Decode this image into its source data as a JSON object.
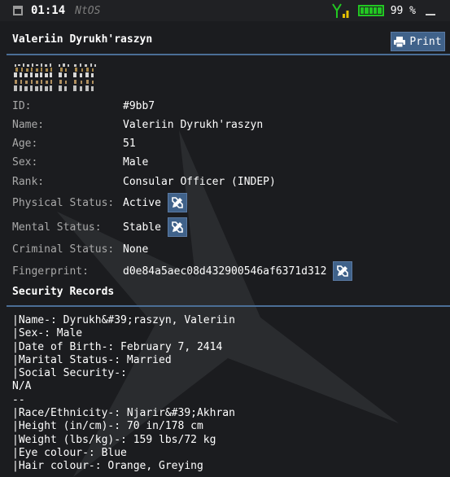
{
  "statusbar": {
    "time": "01:14",
    "os_name": "NtOS",
    "battery_percent": "99 %",
    "icons": [
      "calendar-icon",
      "signal-icon",
      "battery-icon",
      "minimize-icon"
    ],
    "colors": {
      "battery": "#22c722",
      "signal_tower": "#22c722",
      "signal_bars": "#e6c000"
    }
  },
  "header": {
    "title": "Valeriin Dyrukh'raszyn",
    "print_label": "Print",
    "print_icon": "printer-icon"
  },
  "record": {
    "photo_icon": "character-sprite-photo",
    "fields": [
      {
        "label": "ID:",
        "value": "#9bb7",
        "editable": false
      },
      {
        "label": "Name:",
        "value": "Valeriin Dyrukh'raszyn",
        "editable": false
      },
      {
        "label": "Age:",
        "value": "51",
        "editable": false
      },
      {
        "label": "Sex:",
        "value": "Male",
        "editable": false
      },
      {
        "label": "Rank:",
        "value": "Consular Officer (INDEP)",
        "editable": false
      },
      {
        "label": "Physical Status:",
        "value": "Active",
        "editable": true
      },
      {
        "label": "Mental Status:",
        "value": "Stable",
        "editable": true
      },
      {
        "label": "Criminal Status:",
        "value": "None",
        "editable": false
      },
      {
        "label": "Fingerprint:",
        "value": "d0e84a5aec08d432900546af6371d312",
        "editable": true
      }
    ],
    "edit_icon": "pencil-ruler-icon"
  },
  "security": {
    "title": "Security Records",
    "lines": [
      "|Name-: Dyrukh&#39;raszyn, Valeriin",
      "|Sex-: Male",
      "|Date of Birth-: February 7, 2414",
      "|Marital Status-: Married",
      "|Social Security-:",
      "N/A",
      "--",
      "|Race/Ethnicity-: Njarir&#39;Akhran",
      "|Height (in/cm)-: 70 in/178 cm",
      "|Weight (lbs/kg)-: 159 lbs/72 kg",
      "|Eye colour-: Blue",
      "|Hair colour-: Orange, Greying"
    ]
  },
  "theme": {
    "accent": "#40628a",
    "background": "#1b1c1f",
    "divider": "#4b6e96",
    "watermark": "star-emblem"
  }
}
